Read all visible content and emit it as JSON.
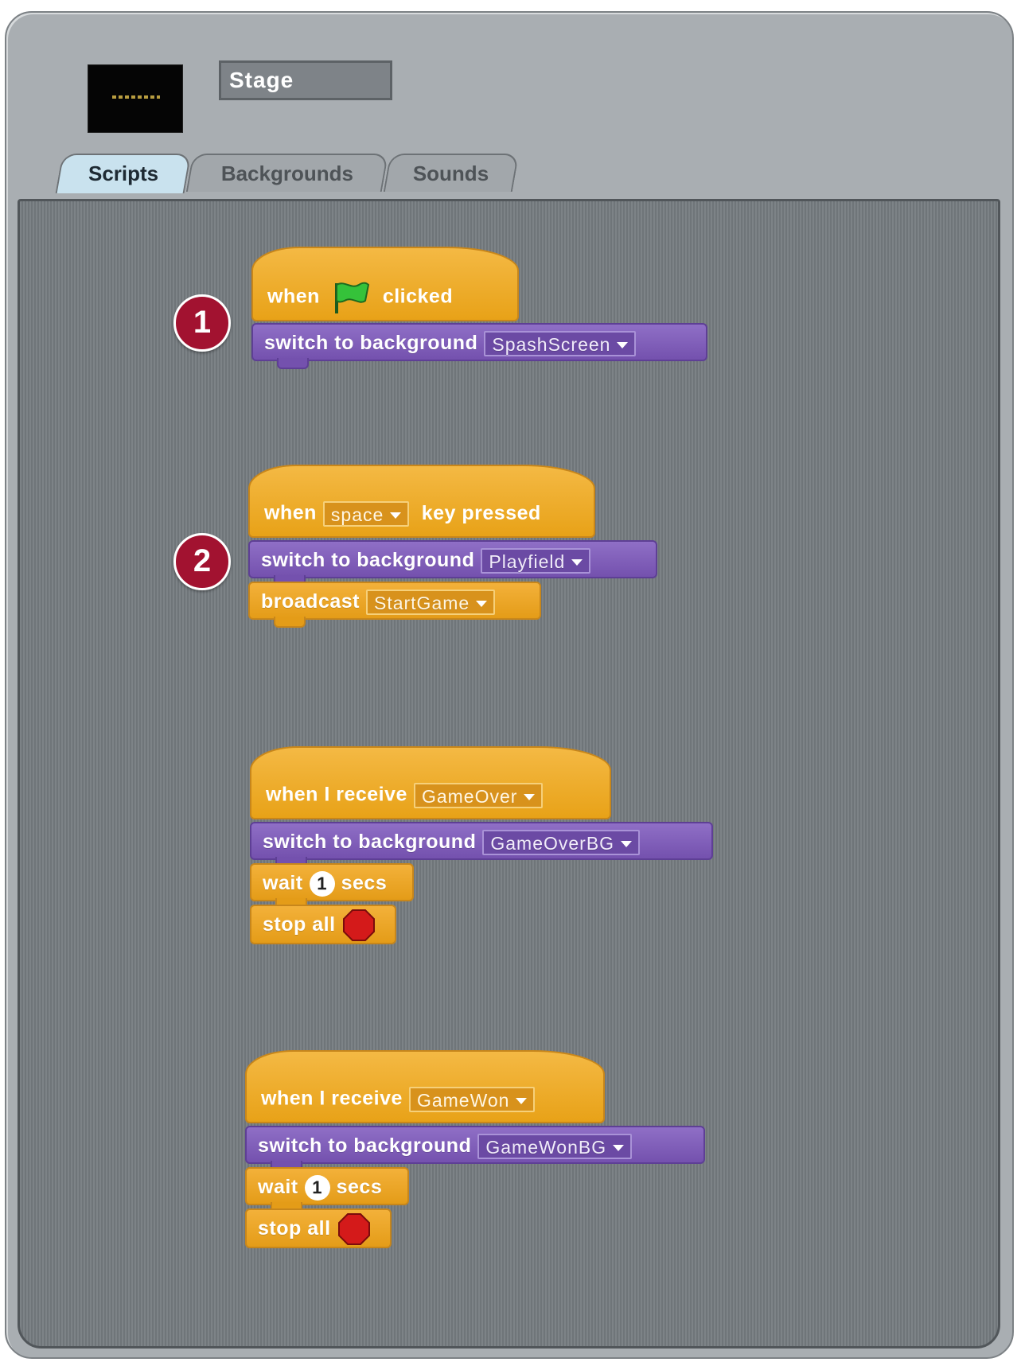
{
  "panel": {
    "sprite_name": "Stage",
    "tabs": [
      {
        "label": "Scripts",
        "active": true
      },
      {
        "label": "Backgrounds",
        "active": false
      },
      {
        "label": "Sounds",
        "active": false
      }
    ]
  },
  "callouts": [
    "1",
    "2"
  ],
  "scripts": {
    "s1": {
      "hat_when": "when",
      "hat_clicked": "clicked",
      "switch_label": "switch to background",
      "switch_value": "SpashScreen"
    },
    "s2": {
      "hat_when": "when",
      "hat_key": "space",
      "hat_rest": "key pressed",
      "switch_label": "switch to background",
      "switch_value": "Playfield",
      "broadcast_label": "broadcast",
      "broadcast_value": "StartGame"
    },
    "s3": {
      "hat_label": "when I receive",
      "hat_value": "GameOver",
      "switch_label": "switch to background",
      "switch_value": "GameOverBG",
      "wait_label": "wait",
      "wait_value": "1",
      "wait_unit": "secs",
      "stop_label": "stop all"
    },
    "s4": {
      "hat_label": "when I receive",
      "hat_value": "GameWon",
      "switch_label": "switch to background",
      "switch_value": "GameWonBG",
      "wait_label": "wait",
      "wait_value": "1",
      "wait_unit": "secs",
      "stop_label": "stop all"
    }
  },
  "colors": {
    "control": "#e6a01a",
    "looks": "#7a57b3",
    "callout": "#a21230",
    "active_tab": "#c9e2ee"
  }
}
